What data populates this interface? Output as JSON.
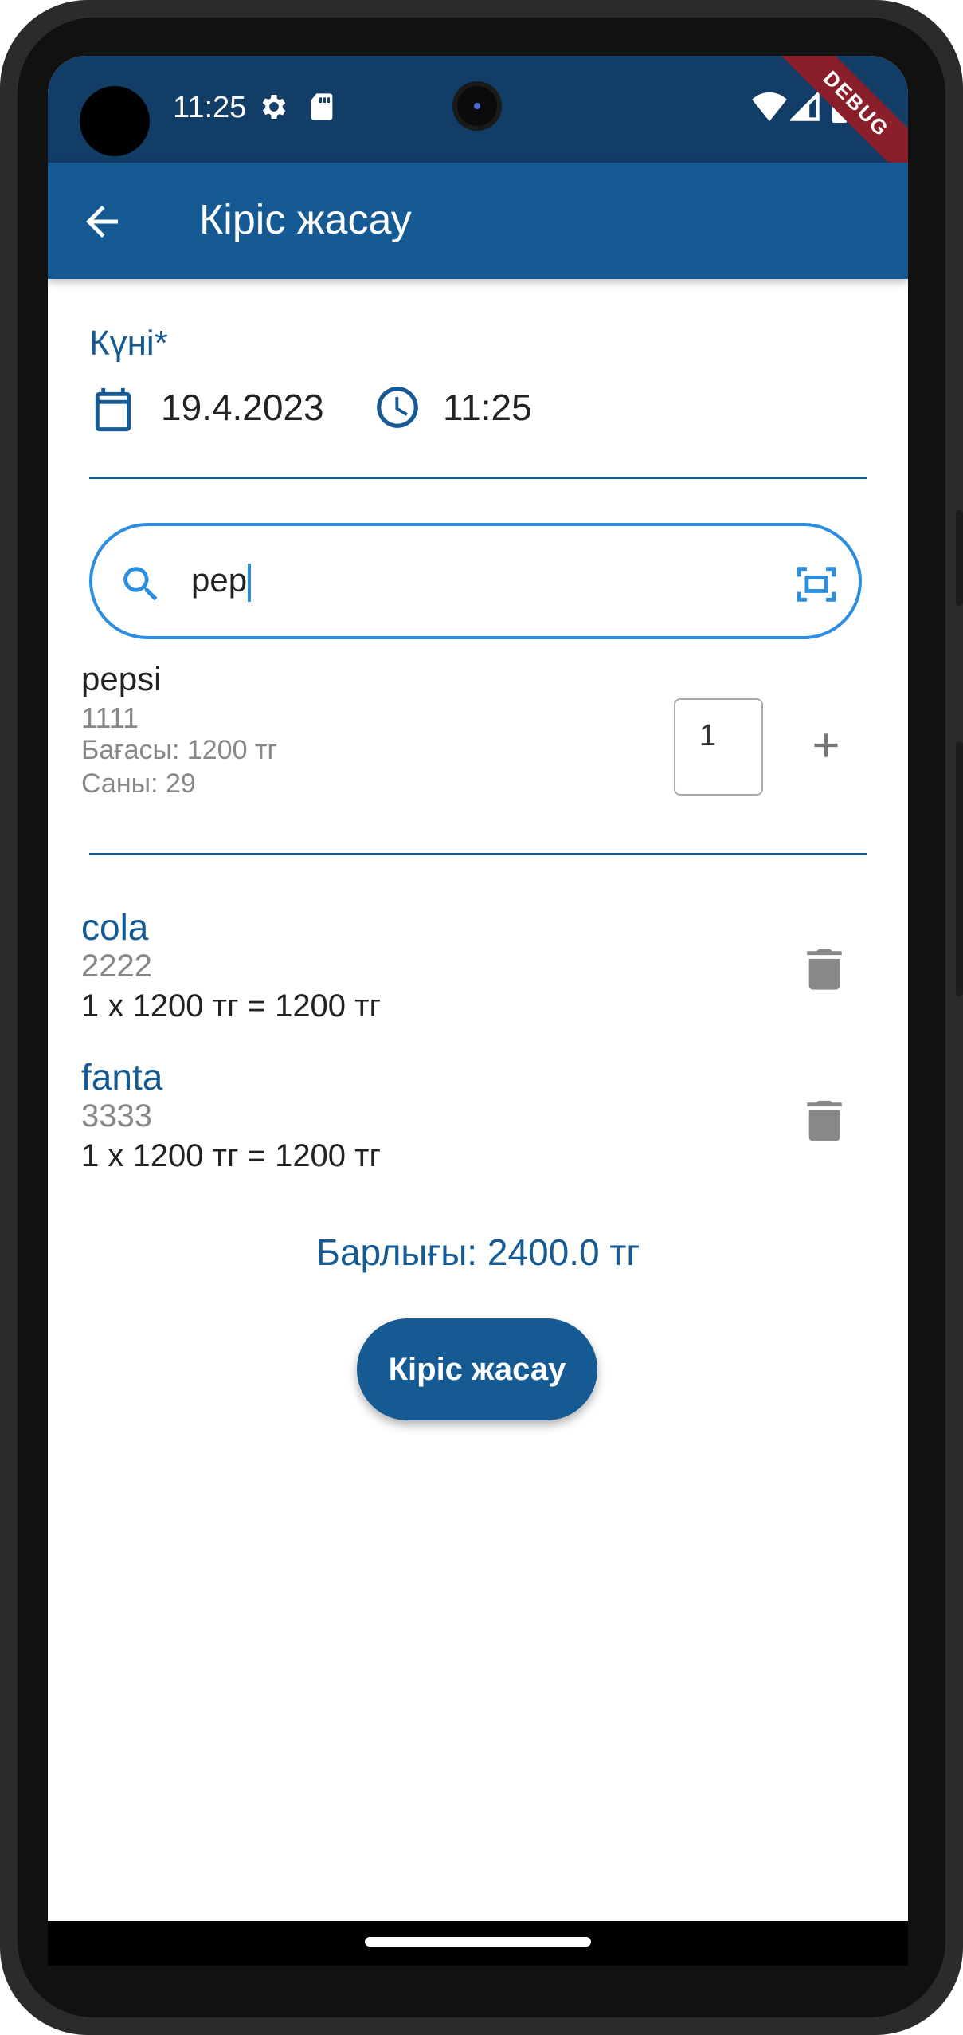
{
  "status_bar": {
    "time": "11:25",
    "icons": [
      "settings-icon",
      "sd-card-icon",
      "wifi-icon",
      "signal-icon",
      "battery-icon"
    ],
    "debug_banner": "DEBUG"
  },
  "app_bar": {
    "back_icon": "arrow-back-icon",
    "title": "Кіріс жасау"
  },
  "date_section": {
    "label": "Күні*",
    "date": "19.4.2023",
    "time": "11:25"
  },
  "search": {
    "value": "pep",
    "leading_icon": "search-icon",
    "trailing_icon": "barcode-scan-icon"
  },
  "search_result": {
    "name": "pepsi",
    "code": "1111",
    "price": "Бағасы: 1200 тг",
    "quantity": "Саны: 29",
    "qty_input": "1",
    "add_icon": "plus-icon"
  },
  "cart_items": [
    {
      "name": "cola",
      "code": "2222",
      "line": "1 x 1200 тг = 1200 тг"
    },
    {
      "name": "fanta",
      "code": "3333",
      "line": "1 x 1200 тг = 1200 тг"
    }
  ],
  "total": "Барлығы: 2400.0 тг",
  "submit_button": "Кіріс жасау",
  "colors": {
    "primary": "#155a92",
    "status_bar": "#123d66",
    "search_border": "#2b8ee0",
    "debug": "#8a1f2b"
  }
}
